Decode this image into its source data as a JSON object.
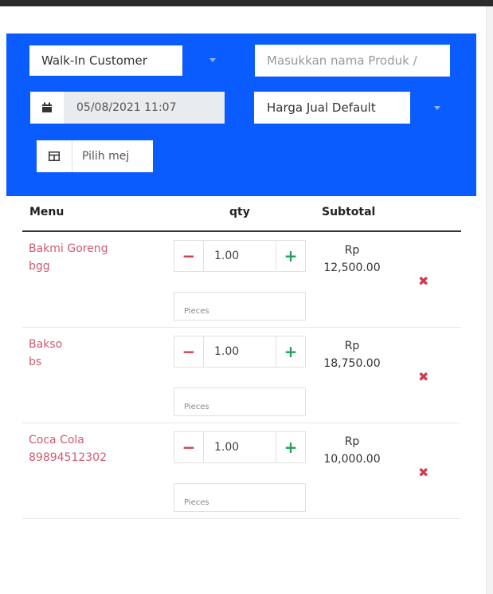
{
  "header": {
    "customer_select": "Walk-In Customer",
    "product_search_placeholder": "Masukkan nama Produk /",
    "datetime": "05/08/2021 11:07",
    "price_list_select": "Harga Jual Default",
    "table_button_label": "Pilih mej"
  },
  "columns": {
    "menu": "Menu",
    "qty": "qty",
    "subtotal": "Subtotal"
  },
  "items": [
    {
      "name": "Bakmi Goreng",
      "code": "bgg",
      "qty": "1.00",
      "unit_placeholder": "Pieces",
      "currency": "Rp",
      "subtotal": "12,500.00"
    },
    {
      "name": "Bakso",
      "code": "bs",
      "qty": "1.00",
      "unit_placeholder": "Pieces",
      "currency": "Rp",
      "subtotal": "18,750.00"
    },
    {
      "name": "Coca Cola",
      "code": "89894512302",
      "qty": "1.00",
      "unit_placeholder": "Pieces",
      "currency": "Rp",
      "subtotal": "10,000.00"
    }
  ],
  "icons": {
    "calendar": "calendar-icon",
    "table": "table-icon",
    "minus": "minus-icon",
    "plus": "plus-icon",
    "remove": "remove-icon",
    "dropdown": "chevron-down-icon"
  },
  "colors": {
    "panel": "#0a5cff",
    "item_name": "#d05a6e",
    "minus": "#d23a4f",
    "plus": "#1fa15a",
    "remove": "#d23a4f"
  },
  "symbols": {
    "minus": "−",
    "plus": "+",
    "remove": "✖"
  }
}
